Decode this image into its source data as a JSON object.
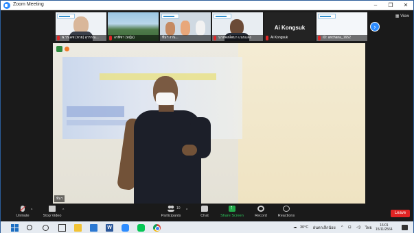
{
  "window": {
    "title": "Zoom Meeting",
    "minimize": "–",
    "restore": "❐",
    "close": "✕"
  },
  "strip": {
    "view_label": "▦ View",
    "next_icon": "›",
    "participants": [
      {
        "label": "พ.วรเดช (หวย) สุวรรณ...",
        "muted": true,
        "kind": "face-elderly"
      },
      {
        "label": "อรพิชา (หญิง)",
        "muted": true,
        "kind": "landscape"
      },
      {
        "label": "ทีมฯ งาน...",
        "muted": false,
        "kind": "group"
      },
      {
        "label": "นายพงษ์พนา แนบแสง",
        "muted": true,
        "kind": "face"
      },
      {
        "label": "Ai Kongsuk",
        "muted": true,
        "kind": "name-only",
        "big_name": "Ai Kongsuk"
      },
      {
        "label": "ID: anchana_1652",
        "muted": true,
        "kind": "logo"
      }
    ]
  },
  "main_video": {
    "name": "ทีมฯ"
  },
  "toolbar": {
    "unmute": "Unmute",
    "stop_video": "Stop Video",
    "participants": "Participants",
    "participants_count": "10",
    "chat": "Chat",
    "share_screen": "Share Screen",
    "record": "Record",
    "reactions": "Reactions",
    "leave": "Leave"
  },
  "taskbar": {
    "weather": "30°C",
    "weather_desc": "ฝนตกเล็กน้อย",
    "tray_arrow": "^",
    "lang": "ไทย",
    "time": "16:01",
    "date": "15/11/2564"
  },
  "colors": {
    "accent": "#2d8cff",
    "leave": "#e02424",
    "share": "#23a94a"
  }
}
